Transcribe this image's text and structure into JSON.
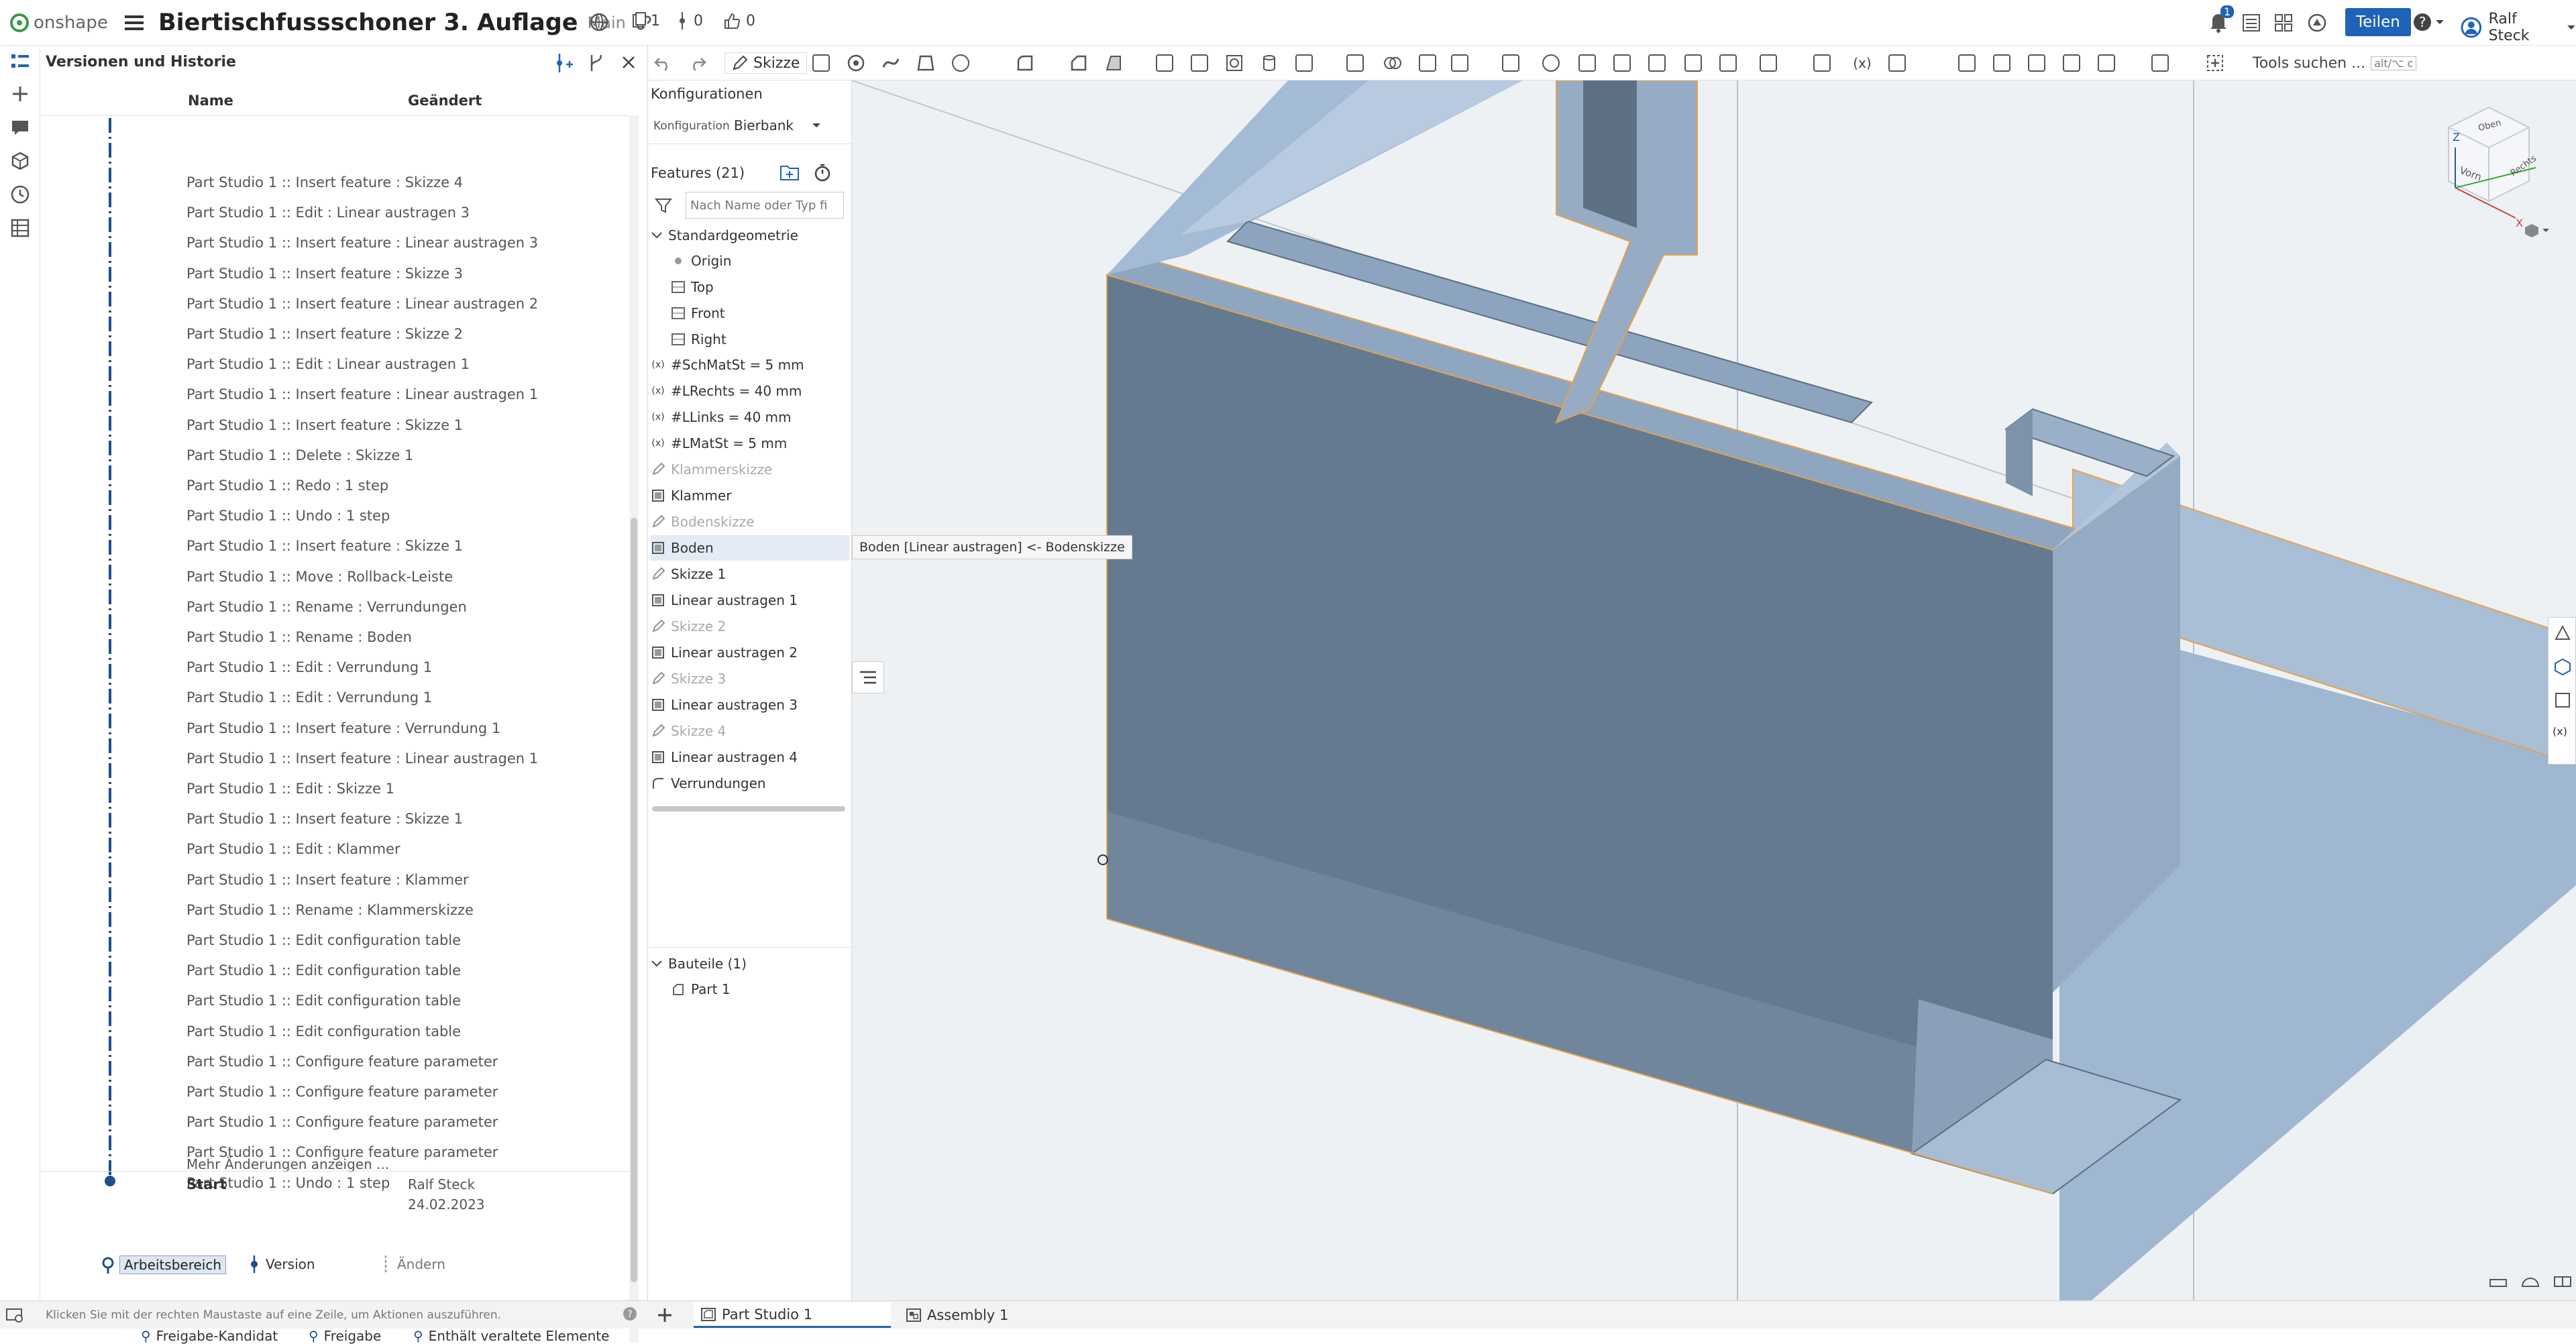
{
  "topbar": {
    "logo_text": "onshape",
    "doc_title": "Biertischfussschoner 3. Auflage",
    "branch": "Main",
    "count_docs": "1",
    "count_versions": "0",
    "count_likes": "0",
    "notif_count": "1",
    "share_label": "Teilen",
    "user_name": "Ralf Steck"
  },
  "toolbar": {
    "sketch_label": "Skizze",
    "search_label": "Tools suchen ...",
    "search_shortcut": "alt/⌥ c"
  },
  "history": {
    "title": "Versionen und Historie",
    "col_name": "Name",
    "col_changed": "Geändert",
    "entries": [
      "Part Studio 1 :: Insert feature : Skizze 4",
      "Part Studio 1 :: Edit : Linear austragen 3",
      "Part Studio 1 :: Insert feature : Linear austragen 3",
      "Part Studio 1 :: Insert feature : Skizze 3",
      "Part Studio 1 :: Insert feature : Linear austragen 2",
      "Part Studio 1 :: Insert feature : Skizze 2",
      "Part Studio 1 :: Edit : Linear austragen 1",
      "Part Studio 1 :: Insert feature : Linear austragen 1",
      "Part Studio 1 :: Insert feature : Skizze 1",
      "Part Studio 1 :: Delete : Skizze 1",
      "Part Studio 1 :: Redo : 1 step",
      "Part Studio 1 :: Undo : 1 step",
      "Part Studio 1 :: Insert feature : Skizze 1",
      "Part Studio 1 :: Move : Rollback-Leiste",
      "Part Studio 1 :: Rename : Verrundungen",
      "Part Studio 1 :: Rename : Boden",
      "Part Studio 1 :: Edit : Verrundung 1",
      "Part Studio 1 :: Edit : Verrundung 1",
      "Part Studio 1 :: Insert feature : Verrundung 1",
      "Part Studio 1 :: Insert feature : Linear austragen 1",
      "Part Studio 1 :: Edit : Skizze 1",
      "Part Studio 1 :: Insert feature : Skizze 1",
      "Part Studio 1 :: Edit : Klammer",
      "Part Studio 1 :: Insert feature : Klammer",
      "Part Studio 1 :: Rename : Klammerskizze",
      "Part Studio 1 :: Edit configuration table",
      "Part Studio 1 :: Edit configuration table",
      "Part Studio 1 :: Edit configuration table",
      "Part Studio 1 :: Edit configuration table",
      "Part Studio 1 :: Configure feature parameter",
      "Part Studio 1 :: Configure feature parameter",
      "Part Studio 1 :: Configure feature parameter",
      "Part Studio 1 :: Configure feature parameter",
      "Part Studio 1 :: Undo : 1 step"
    ],
    "more_label": "Mehr Änderungen anzeigen ...",
    "start_label": "Start",
    "start_user": "Ralf Steck",
    "start_date": "24.02.2023",
    "legend_workspace": "Arbeitsbereich",
    "legend_version": "Version",
    "legend_change": "Ändern",
    "legend_release_candidate": "Freigabe-Kandidat",
    "legend_release": "Freigabe",
    "legend_obsolete": "Enthält veraltete Elemente"
  },
  "features": {
    "config_title": "Konfigurationen",
    "config_label": "Konfiguration",
    "config_value": "Bierbank",
    "features_title": "Features (21)",
    "filter_placeholder": "Nach Name oder Typ fi",
    "default_geometry": "Standardgeometrie",
    "origin": "Origin",
    "plane_top": "Top",
    "plane_front": "Front",
    "plane_right": "Right",
    "items": [
      {
        "label": "#SchMatSt = 5 mm",
        "icon": "variable-icon",
        "dim": false
      },
      {
        "label": "#LRechts = 40 mm",
        "icon": "variable-icon",
        "dim": false
      },
      {
        "label": "#LLinks = 40 mm",
        "icon": "variable-icon",
        "dim": false
      },
      {
        "label": "#LMatSt = 5 mm",
        "icon": "variable-icon",
        "dim": false
      },
      {
        "label": "Klammerskizze",
        "icon": "sketch-icon",
        "dim": true
      },
      {
        "label": "Klammer",
        "icon": "extrude-icon",
        "dim": false
      },
      {
        "label": "Bodenskizze",
        "icon": "sketch-icon",
        "dim": true
      },
      {
        "label": "Boden",
        "icon": "extrude-icon",
        "dim": false
      },
      {
        "label": "Skizze 1",
        "icon": "sketch-icon",
        "dim": false
      },
      {
        "label": "Linear austragen 1",
        "icon": "extrude-icon",
        "dim": false
      },
      {
        "label": "Skizze 2",
        "icon": "sketch-icon",
        "dim": true
      },
      {
        "label": "Linear austragen 2",
        "icon": "extrude-icon",
        "dim": false
      },
      {
        "label": "Skizze 3",
        "icon": "sketch-icon",
        "dim": true
      },
      {
        "label": "Linear austragen 3",
        "icon": "extrude-icon",
        "dim": false
      },
      {
        "label": "Skizze 4",
        "icon": "sketch-icon",
        "dim": true
      },
      {
        "label": "Linear austragen 4",
        "icon": "extrude-icon",
        "dim": false
      },
      {
        "label": "Verrundungen",
        "icon": "fillet-icon",
        "dim": false
      }
    ],
    "tooltip": "Boden [Linear austragen] <- Bodenskizze",
    "parts_title": "Bauteile (1)",
    "part_1": "Part 1"
  },
  "viewcube": {
    "top": "Oben",
    "front": "Vorn",
    "right": "Rechts"
  },
  "bottom": {
    "hint": "Klicken Sie mit der rechten Maustaste auf eine Zeile, um Aktionen auszuführen.",
    "tab_partstudio": "Part Studio 1",
    "tab_assembly": "Assembly 1"
  },
  "colors": {
    "accent": "#1e63b8",
    "part_fill": "#8ea4bd",
    "part_dark": "#5e7286",
    "edge_highlight": "#e8a14a"
  }
}
